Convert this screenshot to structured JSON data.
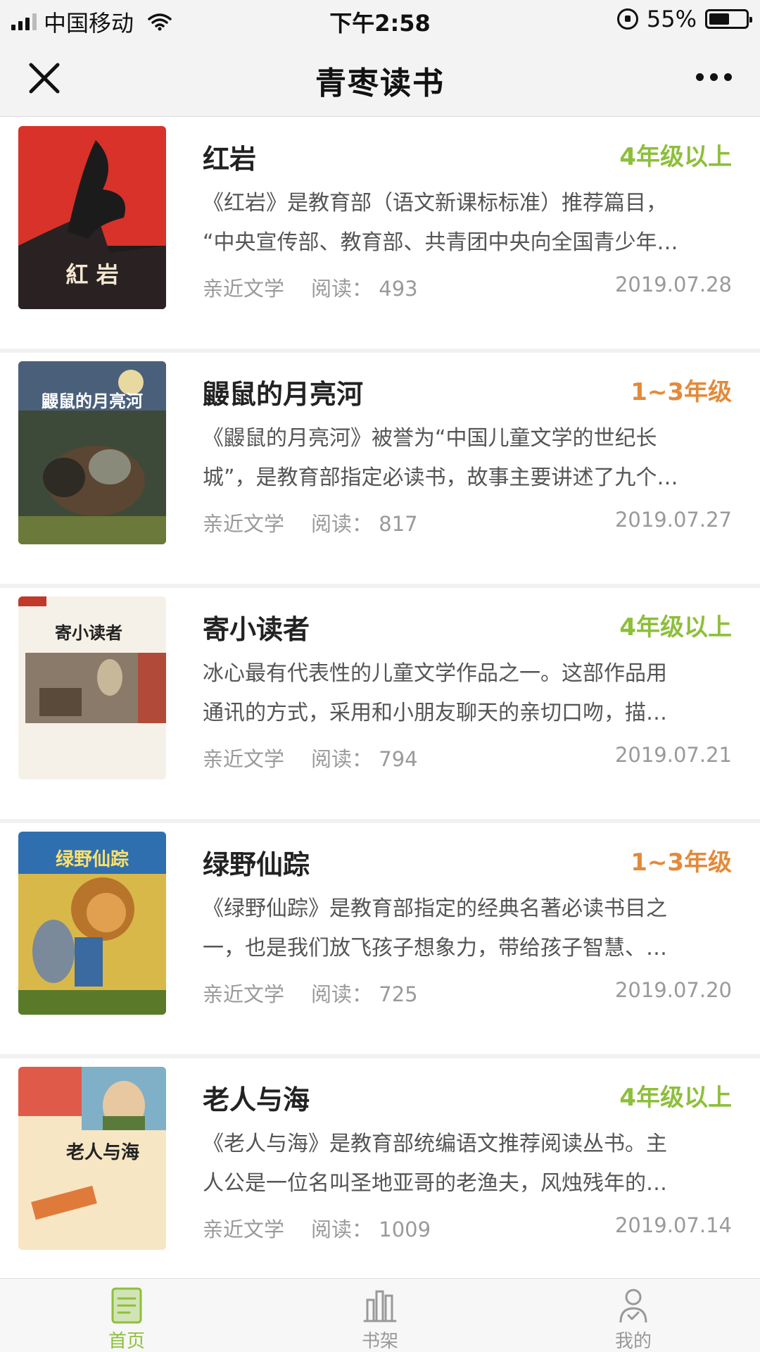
{
  "status_bar": {
    "carrier": "中国移动",
    "time": "下午2:58",
    "battery": "55%",
    "battery_level": 0.55
  },
  "nav": {
    "title": "青枣读书"
  },
  "books": [
    {
      "title": "红岩",
      "grade": "4年级以上",
      "grade_color": "#8dbf3a",
      "desc_lines": [
        "《红岩》是教育部（语文新课标标准）推荐篇目，",
        "“中央宣传部、教育部、共青团中央向全国青少年…"
      ],
      "category": "亲近文学",
      "reads_label": "阅读：",
      "reads": "493",
      "date": "2019.07.28",
      "cover_text": "紅 岩"
    },
    {
      "title": "鼹鼠的月亮河",
      "grade": "1~3年级",
      "grade_color": "#e38a3a",
      "desc_lines": [
        "《鼹鼠的月亮河》被誉为“中国儿童文学的世纪长",
        "城”，是教育部指定必读书，故事主要讲述了九个…"
      ],
      "category": "亲近文学",
      "reads_label": "阅读：",
      "reads": "817",
      "date": "2019.07.27",
      "cover_text": "鼹鼠的月亮河"
    },
    {
      "title": "寄小读者",
      "grade": "4年级以上",
      "grade_color": "#8dbf3a",
      "desc_lines": [
        "冰心最有代表性的儿童文学作品之一。这部作品用",
        "通讯的方式，采用和小朋友聊天的亲切口吻，描…"
      ],
      "category": "亲近文学",
      "reads_label": "阅读：",
      "reads": "794",
      "date": "2019.07.21",
      "cover_text": "寄小读者"
    },
    {
      "title": "绿野仙踪",
      "grade": "1~3年级",
      "grade_color": "#e38a3a",
      "desc_lines": [
        "《绿野仙踪》是教育部指定的经典名著必读书目之",
        "一，也是我们放飞孩子想象力，带给孩子智慧、…"
      ],
      "category": "亲近文学",
      "reads_label": "阅读：",
      "reads": "725",
      "date": "2019.07.20",
      "cover_text": "绿野仙踪"
    },
    {
      "title": "老人与海",
      "grade": "4年级以上",
      "grade_color": "#8dbf3a",
      "desc_lines": [
        "《老人与海》是教育部统编语文推荐阅读丛书。主",
        "人公是一位名叫圣地亚哥的老渔夫，风烛残年的…"
      ],
      "category": "亲近文学",
      "reads_label": "阅读：",
      "reads": "1009",
      "date": "2019.07.14",
      "cover_text": "老人与海"
    }
  ],
  "tabs": [
    {
      "label": "首页",
      "icon": "home-doc-icon",
      "active": true
    },
    {
      "label": "书架",
      "icon": "bookshelf-icon",
      "active": false
    },
    {
      "label": "我的",
      "icon": "profile-icon",
      "active": false
    }
  ]
}
